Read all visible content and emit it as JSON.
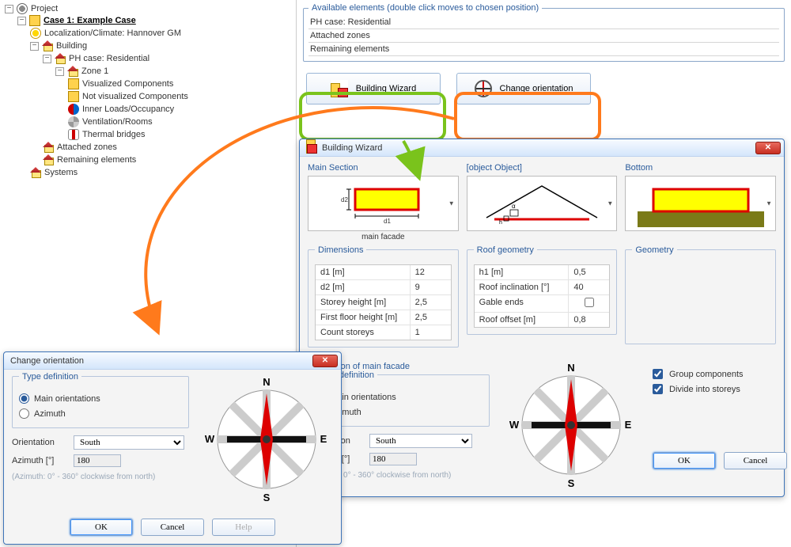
{
  "tree": {
    "root": "Project",
    "case_title": "Case 1: Example Case",
    "localization": "Localization/Climate: Hannover GM",
    "building": "Building",
    "phcase": "PH case: Residential",
    "zone": "Zone 1",
    "vis": "Visualized Components",
    "notvis": "Not visualized Components",
    "inner": "Inner Loads/Occupancy",
    "vent": "Ventilation/Rooms",
    "thermal": "Thermal bridges",
    "attached": "Attached zones",
    "remaining": "Remaining elements",
    "systems": "Systems"
  },
  "available": {
    "legend": "Available elements (double click moves to chosen position)",
    "rows": [
      "PH case: Residential",
      "Attached zones",
      "Remaining elements"
    ]
  },
  "buttons": {
    "wizard": "Building Wizard",
    "change": "Change orientation"
  },
  "change_orientation": {
    "title": "Change orientation",
    "type_def": "Type definition",
    "main_or": "Main orientations",
    "azimuth_radio": "Azimuth",
    "orientation_label": "Orientation",
    "orientation_value": "South",
    "azimuth_label": "Azimuth  [°]",
    "azimuth_value": "180",
    "hint": "(Azimuth: 0° - 360° clockwise from north)",
    "compass": {
      "N": "N",
      "E": "E",
      "S": "S",
      "W": "W"
    },
    "ok": "OK",
    "cancel": "Cancel",
    "help": "Help"
  },
  "wizard_dialog": {
    "title": "Building Wizard",
    "main_section": "Main Section",
    "main_facade_caption": "main facade",
    "roof": {
      "h1_l": "h1  [m]",
      "h1_v": "0,5",
      "ri_l": "Roof inclination  [°]",
      "ri_v": "40",
      "ge_l": "Gable ends",
      "ro_l": "Roof offset  [m]",
      "ro_v": "0,8"
    },
    "bottom": "Bottom",
    "dimensions": "Dimensions",
    "dims": {
      "d1_l": "d1  [m]",
      "d1_v": "12",
      "d2_l": "d2  [m]",
      "d2_v": "9",
      "sh_l": "Storey height  [m]",
      "sh_v": "2,5",
      "ff_l": "First floor height  [m]",
      "ff_v": "2,5",
      "cs_l": "Count storeys",
      "cs_v": "1"
    },
    "roof_geom": "Roof geometry",
    "geometry": "Geometry",
    "orient_section": "Orientation of main facade",
    "type_def": "Type definition",
    "main_or": "Main orientations",
    "azimuth_radio": "Azimuth",
    "orientation_label": "Orientation",
    "orientation_value": "South",
    "azimuth_label": "Azimuth [°]",
    "azimuth_value": "180",
    "hint": "(Azimuth: 0° - 360° clockwise from north)",
    "compass": {
      "N": "N",
      "E": "E",
      "S": "S",
      "W": "W"
    },
    "group_comp": "Group components",
    "divide": "Divide into storeys",
    "ok": "OK",
    "cancel": "Cancel"
  }
}
